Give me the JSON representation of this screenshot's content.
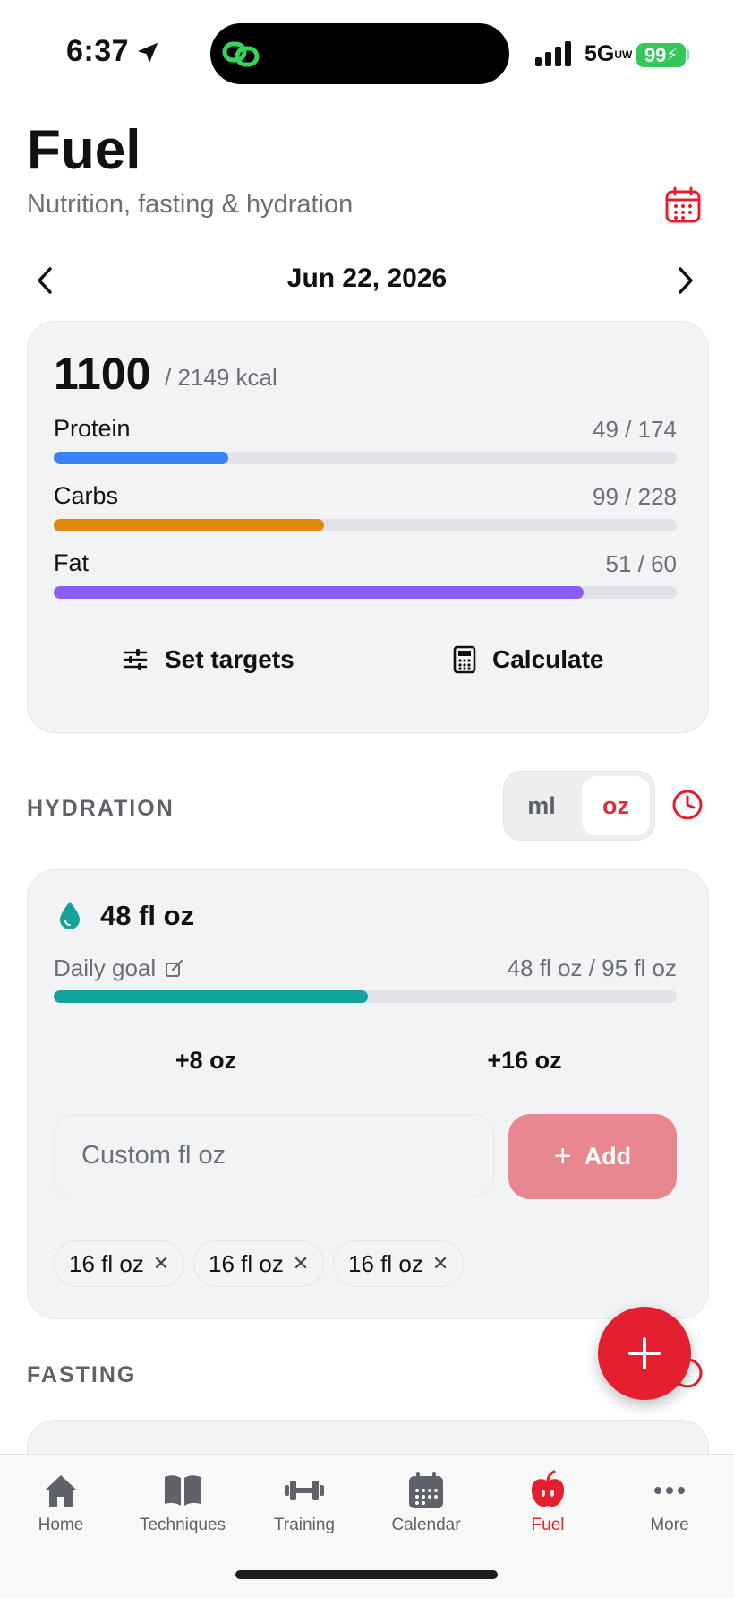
{
  "status_bar": {
    "time": "6:37",
    "network": "5G",
    "network_sub": "UW",
    "battery": "99"
  },
  "header": {
    "title": "Fuel",
    "subtitle": "Nutrition, fasting & hydration",
    "date": "Jun 22, 2026"
  },
  "nutrition": {
    "kcal": "1100",
    "kcal_target": "/ 2149 kcal",
    "macros": [
      {
        "label": "Protein",
        "value": "49 / 174",
        "progress": 0.28,
        "color": "#3b82f6"
      },
      {
        "label": "Carbs",
        "value": "99 / 228",
        "progress": 0.434,
        "color": "#df8a0d"
      },
      {
        "label": "Fat",
        "value": "51 / 60",
        "progress": 0.85,
        "color": "#8b5cf6"
      }
    ],
    "set_targets_label": "Set targets",
    "calculate_label": "Calculate"
  },
  "hydration": {
    "section_title": "HYDRATION",
    "unit_ml": "ml",
    "unit_oz": "oz",
    "selected_unit": "oz",
    "total": "48 fl oz",
    "daily_goal_label": "Daily goal",
    "goal_value": "48 fl oz / 95 fl oz",
    "progress": 0.505,
    "color": "#14a39a",
    "quick_add": [
      "+8 oz",
      "+16 oz"
    ],
    "custom_placeholder": "Custom fl oz",
    "add_label": "Add",
    "entries": [
      "16 fl oz",
      "16 fl oz",
      "16 fl oz"
    ]
  },
  "fasting": {
    "section_title": "FASTING"
  },
  "tabs": [
    {
      "label": "Home",
      "icon": "home-icon",
      "active": false
    },
    {
      "label": "Techniques",
      "icon": "book-icon",
      "active": false
    },
    {
      "label": "Training",
      "icon": "dumbbell-icon",
      "active": false
    },
    {
      "label": "Calendar",
      "icon": "calendar-icon",
      "active": false
    },
    {
      "label": "Fuel",
      "icon": "apple-icon",
      "active": true
    },
    {
      "label": "More",
      "icon": "more-icon",
      "active": false
    }
  ],
  "colors": {
    "accent": "#e41f2f",
    "muted": "#6b6f76",
    "card": "#f2f3f5"
  }
}
